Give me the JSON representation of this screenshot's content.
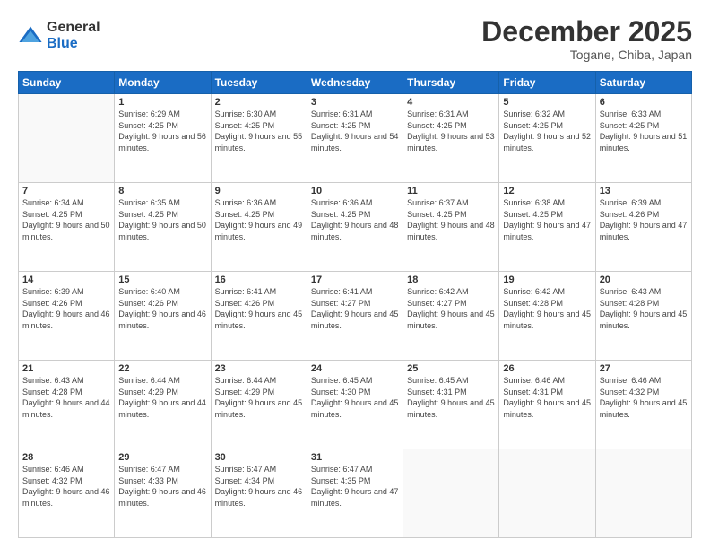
{
  "logo": {
    "general": "General",
    "blue": "Blue"
  },
  "header": {
    "month": "December 2025",
    "location": "Togane, Chiba, Japan"
  },
  "weekdays": [
    "Sunday",
    "Monday",
    "Tuesday",
    "Wednesday",
    "Thursday",
    "Friday",
    "Saturday"
  ],
  "weeks": [
    [
      {
        "day": "",
        "sunrise": "",
        "sunset": "",
        "daylight": ""
      },
      {
        "day": "1",
        "sunrise": "Sunrise: 6:29 AM",
        "sunset": "Sunset: 4:25 PM",
        "daylight": "Daylight: 9 hours and 56 minutes."
      },
      {
        "day": "2",
        "sunrise": "Sunrise: 6:30 AM",
        "sunset": "Sunset: 4:25 PM",
        "daylight": "Daylight: 9 hours and 55 minutes."
      },
      {
        "day": "3",
        "sunrise": "Sunrise: 6:31 AM",
        "sunset": "Sunset: 4:25 PM",
        "daylight": "Daylight: 9 hours and 54 minutes."
      },
      {
        "day": "4",
        "sunrise": "Sunrise: 6:31 AM",
        "sunset": "Sunset: 4:25 PM",
        "daylight": "Daylight: 9 hours and 53 minutes."
      },
      {
        "day": "5",
        "sunrise": "Sunrise: 6:32 AM",
        "sunset": "Sunset: 4:25 PM",
        "daylight": "Daylight: 9 hours and 52 minutes."
      },
      {
        "day": "6",
        "sunrise": "Sunrise: 6:33 AM",
        "sunset": "Sunset: 4:25 PM",
        "daylight": "Daylight: 9 hours and 51 minutes."
      }
    ],
    [
      {
        "day": "7",
        "sunrise": "Sunrise: 6:34 AM",
        "sunset": "Sunset: 4:25 PM",
        "daylight": "Daylight: 9 hours and 50 minutes."
      },
      {
        "day": "8",
        "sunrise": "Sunrise: 6:35 AM",
        "sunset": "Sunset: 4:25 PM",
        "daylight": "Daylight: 9 hours and 50 minutes."
      },
      {
        "day": "9",
        "sunrise": "Sunrise: 6:36 AM",
        "sunset": "Sunset: 4:25 PM",
        "daylight": "Daylight: 9 hours and 49 minutes."
      },
      {
        "day": "10",
        "sunrise": "Sunrise: 6:36 AM",
        "sunset": "Sunset: 4:25 PM",
        "daylight": "Daylight: 9 hours and 48 minutes."
      },
      {
        "day": "11",
        "sunrise": "Sunrise: 6:37 AM",
        "sunset": "Sunset: 4:25 PM",
        "daylight": "Daylight: 9 hours and 48 minutes."
      },
      {
        "day": "12",
        "sunrise": "Sunrise: 6:38 AM",
        "sunset": "Sunset: 4:25 PM",
        "daylight": "Daylight: 9 hours and 47 minutes."
      },
      {
        "day": "13",
        "sunrise": "Sunrise: 6:39 AM",
        "sunset": "Sunset: 4:26 PM",
        "daylight": "Daylight: 9 hours and 47 minutes."
      }
    ],
    [
      {
        "day": "14",
        "sunrise": "Sunrise: 6:39 AM",
        "sunset": "Sunset: 4:26 PM",
        "daylight": "Daylight: 9 hours and 46 minutes."
      },
      {
        "day": "15",
        "sunrise": "Sunrise: 6:40 AM",
        "sunset": "Sunset: 4:26 PM",
        "daylight": "Daylight: 9 hours and 46 minutes."
      },
      {
        "day": "16",
        "sunrise": "Sunrise: 6:41 AM",
        "sunset": "Sunset: 4:26 PM",
        "daylight": "Daylight: 9 hours and 45 minutes."
      },
      {
        "day": "17",
        "sunrise": "Sunrise: 6:41 AM",
        "sunset": "Sunset: 4:27 PM",
        "daylight": "Daylight: 9 hours and 45 minutes."
      },
      {
        "day": "18",
        "sunrise": "Sunrise: 6:42 AM",
        "sunset": "Sunset: 4:27 PM",
        "daylight": "Daylight: 9 hours and 45 minutes."
      },
      {
        "day": "19",
        "sunrise": "Sunrise: 6:42 AM",
        "sunset": "Sunset: 4:28 PM",
        "daylight": "Daylight: 9 hours and 45 minutes."
      },
      {
        "day": "20",
        "sunrise": "Sunrise: 6:43 AM",
        "sunset": "Sunset: 4:28 PM",
        "daylight": "Daylight: 9 hours and 45 minutes."
      }
    ],
    [
      {
        "day": "21",
        "sunrise": "Sunrise: 6:43 AM",
        "sunset": "Sunset: 4:28 PM",
        "daylight": "Daylight: 9 hours and 44 minutes."
      },
      {
        "day": "22",
        "sunrise": "Sunrise: 6:44 AM",
        "sunset": "Sunset: 4:29 PM",
        "daylight": "Daylight: 9 hours and 44 minutes."
      },
      {
        "day": "23",
        "sunrise": "Sunrise: 6:44 AM",
        "sunset": "Sunset: 4:29 PM",
        "daylight": "Daylight: 9 hours and 45 minutes."
      },
      {
        "day": "24",
        "sunrise": "Sunrise: 6:45 AM",
        "sunset": "Sunset: 4:30 PM",
        "daylight": "Daylight: 9 hours and 45 minutes."
      },
      {
        "day": "25",
        "sunrise": "Sunrise: 6:45 AM",
        "sunset": "Sunset: 4:31 PM",
        "daylight": "Daylight: 9 hours and 45 minutes."
      },
      {
        "day": "26",
        "sunrise": "Sunrise: 6:46 AM",
        "sunset": "Sunset: 4:31 PM",
        "daylight": "Daylight: 9 hours and 45 minutes."
      },
      {
        "day": "27",
        "sunrise": "Sunrise: 6:46 AM",
        "sunset": "Sunset: 4:32 PM",
        "daylight": "Daylight: 9 hours and 45 minutes."
      }
    ],
    [
      {
        "day": "28",
        "sunrise": "Sunrise: 6:46 AM",
        "sunset": "Sunset: 4:32 PM",
        "daylight": "Daylight: 9 hours and 46 minutes."
      },
      {
        "day": "29",
        "sunrise": "Sunrise: 6:47 AM",
        "sunset": "Sunset: 4:33 PM",
        "daylight": "Daylight: 9 hours and 46 minutes."
      },
      {
        "day": "30",
        "sunrise": "Sunrise: 6:47 AM",
        "sunset": "Sunset: 4:34 PM",
        "daylight": "Daylight: 9 hours and 46 minutes."
      },
      {
        "day": "31",
        "sunrise": "Sunrise: 6:47 AM",
        "sunset": "Sunset: 4:35 PM",
        "daylight": "Daylight: 9 hours and 47 minutes."
      },
      {
        "day": "",
        "sunrise": "",
        "sunset": "",
        "daylight": ""
      },
      {
        "day": "",
        "sunrise": "",
        "sunset": "",
        "daylight": ""
      },
      {
        "day": "",
        "sunrise": "",
        "sunset": "",
        "daylight": ""
      }
    ]
  ]
}
